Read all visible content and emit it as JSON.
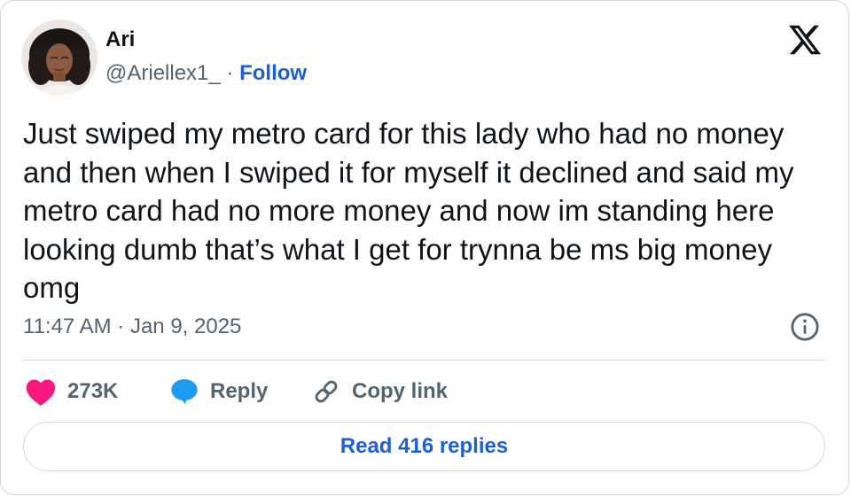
{
  "tweet": {
    "author": {
      "name": "Ari",
      "handle": "@Ariellex1_",
      "separator": " · ",
      "follow_label": "Follow"
    },
    "text": "Just swiped my metro card for this lady who had no money and then when I swiped it for myself it declined and said my metro card had no more money and now im standing here looking dumb that’s what I get for trynna be ms big money omg",
    "timestamp": "11:47 AM · Jan 9, 2025",
    "actions": {
      "like_count": "273K",
      "reply_label": "Reply",
      "copy_link_label": "Copy link"
    },
    "read_replies_label": "Read 416 replies"
  },
  "icons": {
    "brand": "x-logo-icon",
    "like": "heart-icon",
    "reply": "speech-bubble-icon",
    "copy": "link-icon",
    "info": "info-icon"
  },
  "colors": {
    "accent": "#1d5fd6",
    "like": "#f91880",
    "reply": "#1d9bf0",
    "secondary_text": "#536471",
    "border": "#cfd9de"
  }
}
